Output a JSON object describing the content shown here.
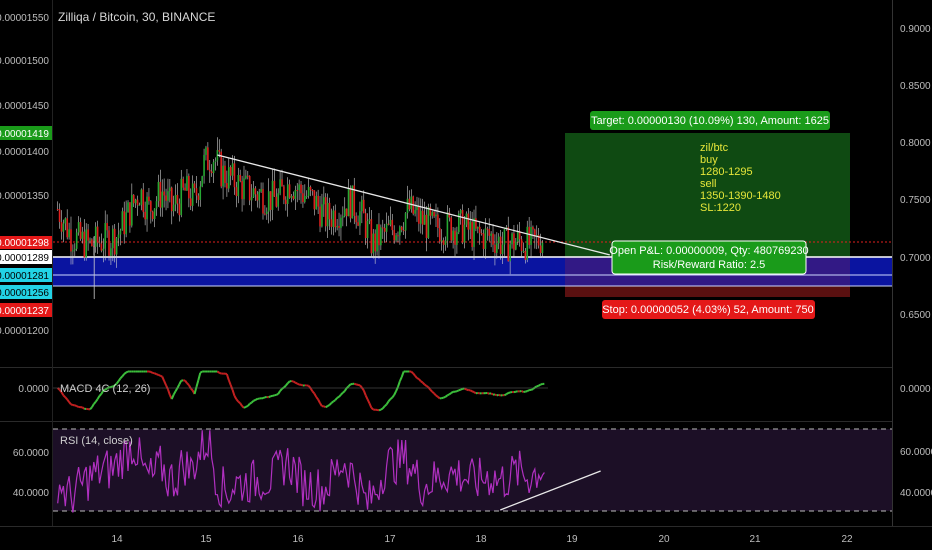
{
  "header": {
    "title": "Zilliqa / Bitcoin, 30, BINANCE"
  },
  "colors": {
    "bg": "#000000",
    "up": "#26a833",
    "down": "#e0201e",
    "wick": "#cfcfcf",
    "zone_blue": "#0a14a0",
    "target_green": "#0f4a12",
    "stop_red": "#5a1010",
    "macd_up": "#3cbf3c",
    "macd_down": "#c22020",
    "rsi": "#b030c0",
    "rsi_band": "#1c0f26",
    "label_green": "#1a9b1a",
    "label_red": "#e41818",
    "label_cyan": "#22d3e6",
    "trendline": "#e8e8e8"
  },
  "price_axis": {
    "ticks": [
      "0.00001550",
      "0.00001500",
      "0.00001450",
      "0.00001400",
      "0.00001350",
      "0.00001200"
    ],
    "labels": [
      {
        "text": "0.00001419",
        "color": "green"
      },
      {
        "text": "0.00001298",
        "color": "red"
      },
      {
        "text": "0.00001289",
        "color": "white"
      },
      {
        "text": "0.00001281",
        "color": "cyan"
      },
      {
        "text": "0.00001256",
        "color": "cyan"
      },
      {
        "text": "0.00001237",
        "color": "red"
      }
    ]
  },
  "right_axis": {
    "ticks": [
      "0.9000",
      "0.8500",
      "0.8000",
      "0.7500",
      "0.7000",
      "0.6500"
    ],
    "macd_tick": "0.0000",
    "rsi_ticks": [
      "60.0000",
      "40.0000"
    ]
  },
  "left_axis": {
    "macd_tick": "0.0000",
    "rsi_ticks": [
      "60.0000",
      "40.0000"
    ]
  },
  "x_axis": {
    "ticks": [
      "14",
      "15",
      "16",
      "17",
      "18",
      "19",
      "20",
      "21",
      "22"
    ]
  },
  "position": {
    "target_label": "Target: 0.00000130 (10.09%) 130, Amount: 1625",
    "stop_label": "Stop: 0.00000052 (4.03%) 52, Amount: 750",
    "pnl_line1": "Open P&L: 0.00000009, Qty: 480769230",
    "pnl_line2": "Risk/Reward Ratio: 2.5"
  },
  "note": {
    "lines": [
      "zil/btc",
      "buy",
      "1280-1295",
      "sell",
      "1350-1390-1480",
      "SL:1220"
    ]
  },
  "indicators": {
    "macd_label": "MACD 4C (12, 26)",
    "rsi_label": "RSI (14, close)"
  },
  "chart_data": {
    "type": "candlestick",
    "symbol": "Zilliqa / Bitcoin",
    "interval": "30",
    "exchange": "BINANCE",
    "ylim": [
      1.165e-05,
      1.57e-05
    ],
    "x_day_range": [
      13.3,
      22.2
    ],
    "price_path": [
      [
        13.35,
        1.34e-05
      ],
      [
        13.5,
        1.31e-05
      ],
      [
        13.7,
        1.3e-05
      ],
      [
        13.85,
        1.305e-05
      ],
      [
        14.0,
        1.31e-05
      ],
      [
        14.1,
        1.33e-05
      ],
      [
        14.25,
        1.36e-05
      ],
      [
        14.35,
        1.34e-05
      ],
      [
        14.5,
        1.36e-05
      ],
      [
        14.6,
        1.34e-05
      ],
      [
        14.75,
        1.36e-05
      ],
      [
        14.85,
        1.35e-05
      ],
      [
        14.95,
        1.39e-05
      ],
      [
        15.05,
        1.4e-05
      ],
      [
        15.15,
        1.38e-05
      ],
      [
        15.3,
        1.37e-05
      ],
      [
        15.45,
        1.36e-05
      ],
      [
        15.6,
        1.355e-05
      ],
      [
        15.75,
        1.35e-05
      ],
      [
        15.9,
        1.37e-05
      ],
      [
        16.0,
        1.36e-05
      ],
      [
        16.15,
        1.35e-05
      ],
      [
        16.3,
        1.33e-05
      ],
      [
        16.45,
        1.34e-05
      ],
      [
        16.55,
        1.35e-05
      ],
      [
        16.7,
        1.33e-05
      ],
      [
        16.8,
        1.3e-05
      ],
      [
        16.9,
        1.31e-05
      ],
      [
        17.05,
        1.32e-05
      ],
      [
        17.2,
        1.34e-05
      ],
      [
        17.3,
        1.33e-05
      ],
      [
        17.45,
        1.32e-05
      ],
      [
        17.6,
        1.32e-05
      ],
      [
        17.8,
        1.32e-05
      ],
      [
        17.95,
        1.31e-05
      ],
      [
        18.1,
        1.31e-05
      ],
      [
        18.25,
        1.3e-05
      ],
      [
        18.4,
        1.305e-05
      ],
      [
        18.55,
        1.3e-05
      ],
      [
        18.68,
        1.31e-05
      ]
    ],
    "zones": {
      "buy_low": 1.28e-05,
      "buy_high": 1.295e-05,
      "current": 1.298e-05,
      "entry": 1.289e-05,
      "zone_low": 1.256e-05,
      "zone_high": 1.281e-05,
      "target": 1.419e-05,
      "stop": 1.237e-05
    },
    "trendline": [
      [
        15.1,
        1.4e-05
      ],
      [
        19.4,
        1.289e-05
      ]
    ],
    "rsi": {
      "ylim": [
        25,
        75
      ],
      "overbought": 70,
      "oversold": 30,
      "trendline": [
        [
          18.2,
          30.5
        ],
        [
          19.3,
          49.5
        ]
      ]
    }
  }
}
